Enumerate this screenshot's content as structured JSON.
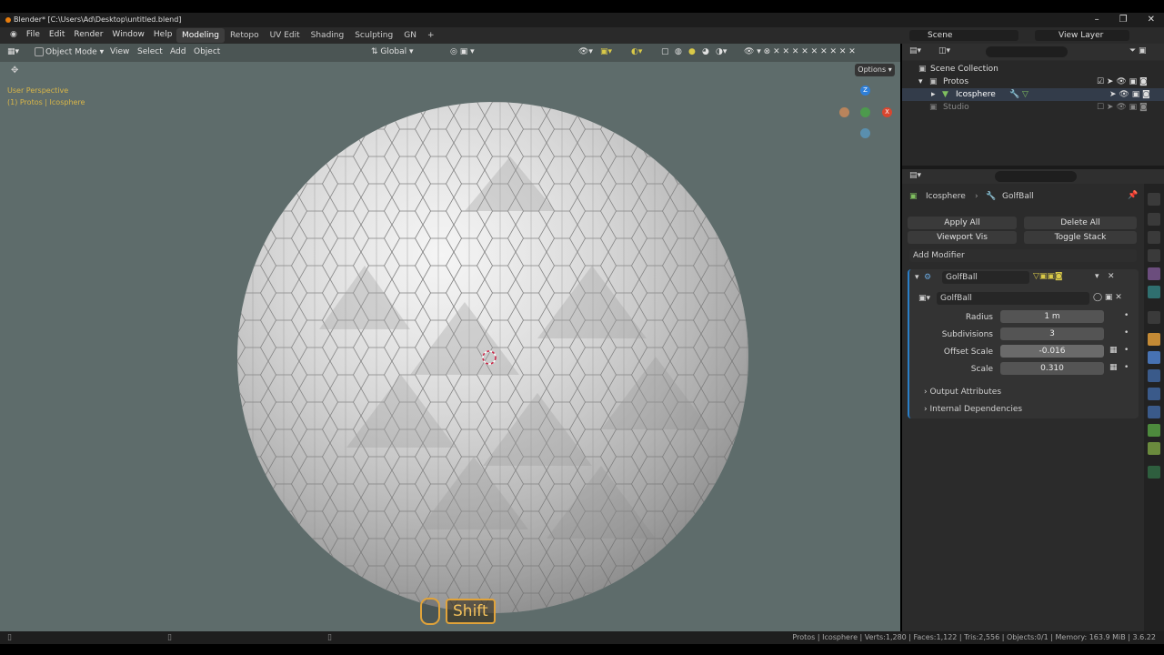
{
  "window": {
    "title": "Blender* [C:\\Users\\Ad\\Desktop\\untitled.blend]",
    "controls": [
      "–",
      "❐",
      "✕"
    ]
  },
  "menu": [
    "File",
    "Edit",
    "Render",
    "Window",
    "Help"
  ],
  "workspaces": [
    "Modeling",
    "Retopo",
    "UV Edit",
    "Shading",
    "Sculpting",
    "GN",
    "+"
  ],
  "scene": {
    "name": "Scene",
    "view_layer": "View Layer"
  },
  "viewport": {
    "mode": "Object Mode",
    "menus": [
      "View",
      "Select",
      "Add",
      "Object"
    ],
    "orientation": "Global",
    "options_label": "Options",
    "overlay_line1": "User Perspective",
    "overlay_line2": "(1) Protos | Icosphere",
    "gizmo": {
      "z": "Z",
      "x": "X"
    },
    "shift_key": "Shift"
  },
  "outliner": {
    "rows": [
      "Scene Collection",
      "Protos",
      "Icosphere",
      "Studio"
    ]
  },
  "properties": {
    "breadcrumb_object": "Icosphere",
    "breadcrumb_modifier": "GolfBall",
    "apply_all": "Apply All",
    "delete_all": "Delete All",
    "viewport_vis": "Viewport Vis",
    "toggle_stack": "Toggle Stack",
    "add_modifier": "Add Modifier",
    "modifier_name": "GolfBall",
    "node_group": "GolfBall",
    "fields": [
      {
        "label": "Radius",
        "value": "1 m"
      },
      {
        "label": "Subdivisions",
        "value": "3"
      },
      {
        "label": "Offset Scale",
        "value": "-0.016"
      },
      {
        "label": "Scale",
        "value": "0.310"
      }
    ],
    "output_attributes": "Output Attributes",
    "internal_dependencies": "Internal Dependencies"
  },
  "status": "Protos | Icosphere | Verts:1,280 | Faces:1,122 | Tris:2,556 | Objects:0/1 | Memory: 163.9 MiB | 3.6.22",
  "colors": {
    "accent": "#4772b3",
    "highlight": "#d9b648",
    "viewport_bg": "#5e6c6b"
  }
}
